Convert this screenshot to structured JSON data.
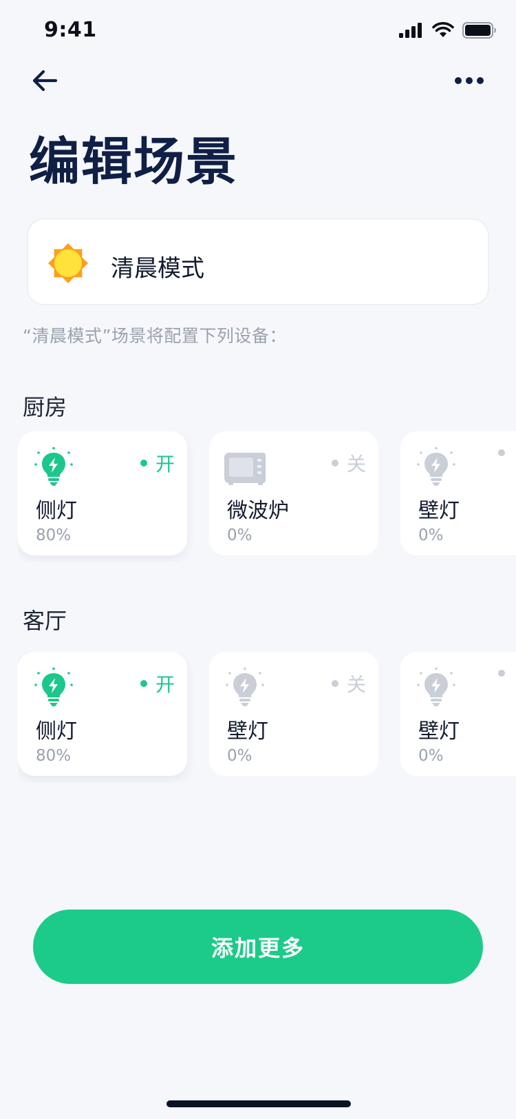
{
  "status_bar": {
    "time": "9:41"
  },
  "header": {
    "title": "编辑场景"
  },
  "scene": {
    "name": "清晨模式",
    "icon": "sun-icon"
  },
  "description": "“清晨模式”场景将配置下列设备：",
  "sections": [
    {
      "title": "厨房",
      "devices": [
        {
          "name": "侧灯",
          "value": "80%",
          "state": "on",
          "state_label": "开",
          "icon": "bulb-icon"
        },
        {
          "name": "微波炉",
          "value": "0%",
          "state": "off",
          "state_label": "关",
          "icon": "microwave-icon"
        },
        {
          "name": "壁灯",
          "value": "0%",
          "state": "off",
          "state_label": "",
          "icon": "bulb-icon"
        }
      ]
    },
    {
      "title": "客厅",
      "devices": [
        {
          "name": "侧灯",
          "value": "80%",
          "state": "on",
          "state_label": "开",
          "icon": "bulb-icon"
        },
        {
          "name": "壁灯",
          "value": "0%",
          "state": "off",
          "state_label": "关",
          "icon": "bulb-icon"
        },
        {
          "name": "壁灯",
          "value": "0%",
          "state": "off",
          "state_label": "",
          "icon": "bulb-icon"
        }
      ]
    }
  ],
  "actions": {
    "add_more": "添加更多"
  },
  "colors": {
    "accent": "#1ccb89",
    "on": "#1bc78b",
    "off": "#c9ced7",
    "title": "#0f1f45",
    "background": "#f5f7fb"
  }
}
